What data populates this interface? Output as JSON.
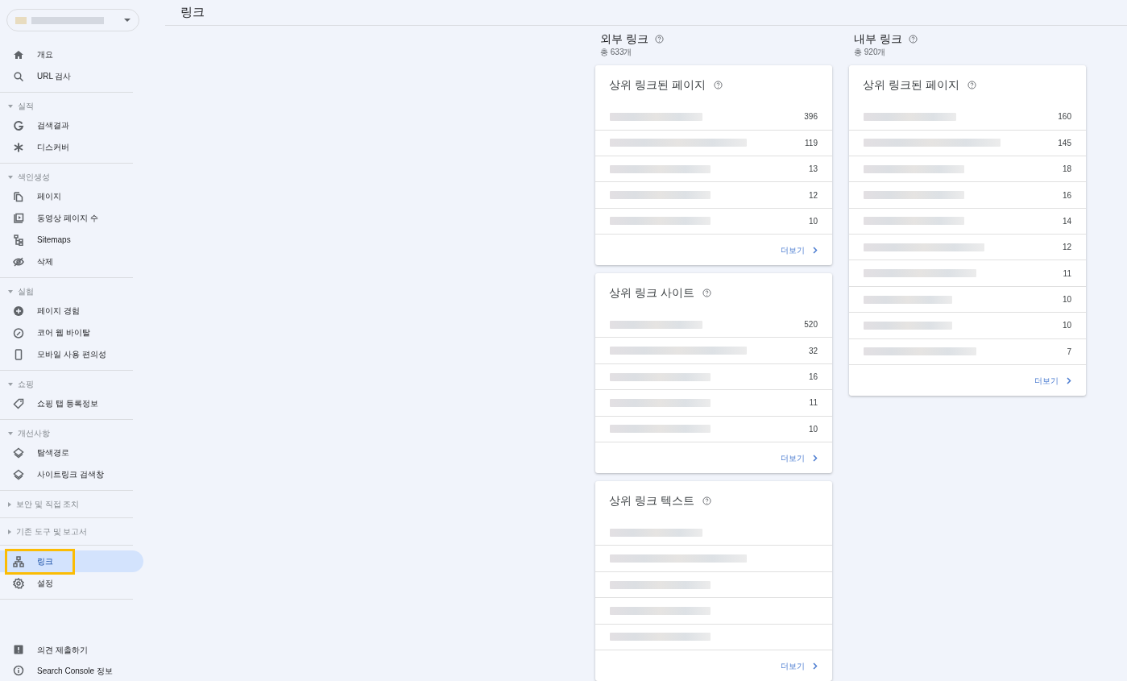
{
  "page_title": "링크",
  "nav": [
    {
      "items": [
        {
          "label": "개요",
          "selected": false,
          "highlighted": false
        },
        {
          "label": "URL 검사",
          "selected": false,
          "highlighted": false
        }
      ]
    },
    {
      "label": "실적",
      "expanded": true,
      "items": [
        {
          "label": "검색결과",
          "selected": false,
          "highlighted": false
        },
        {
          "label": "디스커버",
          "selected": false,
          "highlighted": false
        }
      ]
    },
    {
      "label": "색인생성",
      "expanded": true,
      "items": [
        {
          "label": "페이지",
          "selected": false,
          "highlighted": false
        },
        {
          "label": "동영상 페이지 수",
          "selected": false,
          "highlighted": false
        },
        {
          "label": "Sitemaps",
          "selected": false,
          "highlighted": false
        },
        {
          "label": "삭제",
          "selected": false,
          "highlighted": false
        }
      ]
    },
    {
      "label": "실험",
      "expanded": true,
      "items": [
        {
          "label": "페이지 경험",
          "selected": false,
          "highlighted": false
        },
        {
          "label": "코어 웹 바이탈",
          "selected": false,
          "highlighted": false
        },
        {
          "label": "모바일 사용 편의성",
          "selected": false,
          "highlighted": false
        }
      ]
    },
    {
      "label": "쇼핑",
      "expanded": true,
      "items": [
        {
          "label": "쇼핑 탭 등록정보",
          "selected": false,
          "highlighted": false
        }
      ]
    },
    {
      "label": "개선사항",
      "expanded": true,
      "items": [
        {
          "label": "탐색경로",
          "selected": false,
          "highlighted": false
        },
        {
          "label": "사이트링크 검색창",
          "selected": false,
          "highlighted": false
        }
      ]
    },
    {
      "label": "보안 및 직접 조치",
      "expanded": false
    },
    {
      "label": "기존 도구 및 보고서",
      "expanded": false
    },
    {
      "items": [
        {
          "label": "링크",
          "selected": true,
          "highlighted": true
        },
        {
          "label": "설정",
          "selected": false,
          "highlighted": false
        }
      ]
    }
  ],
  "footer_nav": [
    {
      "label": "의견 제출하기"
    },
    {
      "label": "Search Console 정보"
    }
  ],
  "columns": [
    {
      "title": "외부 링크",
      "total": "총 633개",
      "cards": [
        {
          "title": "상위 링크된 페이지",
          "more": "더보기",
          "rows": [
            {
              "blurred": true,
              "count": "396"
            },
            {
              "blurred": true,
              "count": "119"
            },
            {
              "blurred": true,
              "count": "13"
            },
            {
              "blurred": true,
              "count": "12"
            },
            {
              "blurred": true,
              "count": "10"
            }
          ]
        },
        {
          "title": "상위 링크 사이트",
          "more": "더보기",
          "rows": [
            {
              "blurred": true,
              "count": "520"
            },
            {
              "blurred": true,
              "count": "32"
            },
            {
              "blurred": true,
              "count": "16"
            },
            {
              "blurred": true,
              "count": "11"
            },
            {
              "blurred": true,
              "count": "10"
            }
          ]
        },
        {
          "title": "상위 링크 텍스트",
          "more": "더보기",
          "rows": [
            {
              "blurred": true
            },
            {
              "blurred": true
            },
            {
              "blurred": true
            },
            {
              "blurred": true
            },
            {
              "blurred": true
            }
          ]
        }
      ]
    },
    {
      "title": "내부 링크",
      "total": "총 920개",
      "cards": [
        {
          "title": "상위 링크된 페이지",
          "more": "더보기",
          "rows": [
            {
              "blurred": true,
              "count": "160"
            },
            {
              "blurred": true,
              "count": "145"
            },
            {
              "blurred": true,
              "count": "18"
            },
            {
              "blurred": true,
              "count": "16"
            },
            {
              "blurred": true,
              "count": "14"
            },
            {
              "blurred": true,
              "count": "12"
            },
            {
              "blurred": true,
              "count": "11"
            },
            {
              "blurred": true,
              "count": "10"
            },
            {
              "blurred": true,
              "count": "10"
            },
            {
              "blurred": true,
              "count": "7"
            }
          ]
        }
      ]
    }
  ]
}
